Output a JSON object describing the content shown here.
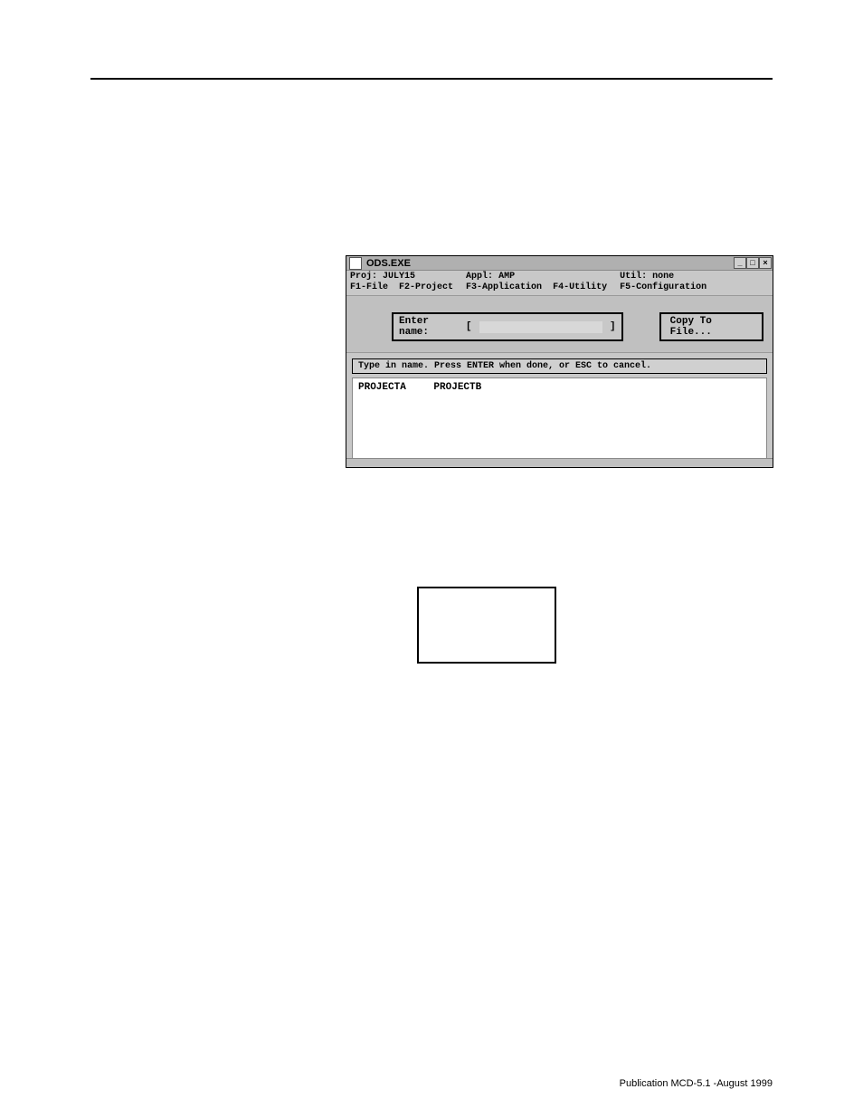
{
  "titlebar": {
    "title": "ODS.EXE"
  },
  "status": {
    "proj_label": "Proj:",
    "proj_value": "JULY15",
    "appl_label": "Appl:",
    "appl_value": "AMP",
    "util_label": "Util:",
    "util_value": "none"
  },
  "menus": {
    "file": "F1-File",
    "project": "F2-Project",
    "application": "F3-Application",
    "utility": "F4-Utility",
    "configuration": "F5-Configuration"
  },
  "dialog": {
    "enter_name_label": "Enter name:",
    "enter_name_value": "",
    "enter_name_brackets_left": "[",
    "enter_name_brackets_right": "]",
    "copy_button": "Copy To File...",
    "hint": "Type in name.    Press ENTER when done, or ESC to cancel."
  },
  "projects": {
    "items": [
      "PROJECTA",
      "PROJECTB"
    ]
  },
  "footer": {
    "text": "Publication MCD-5.1 -August 1999"
  },
  "winbuttons": {
    "min": "_",
    "max": "□",
    "close": "×"
  }
}
